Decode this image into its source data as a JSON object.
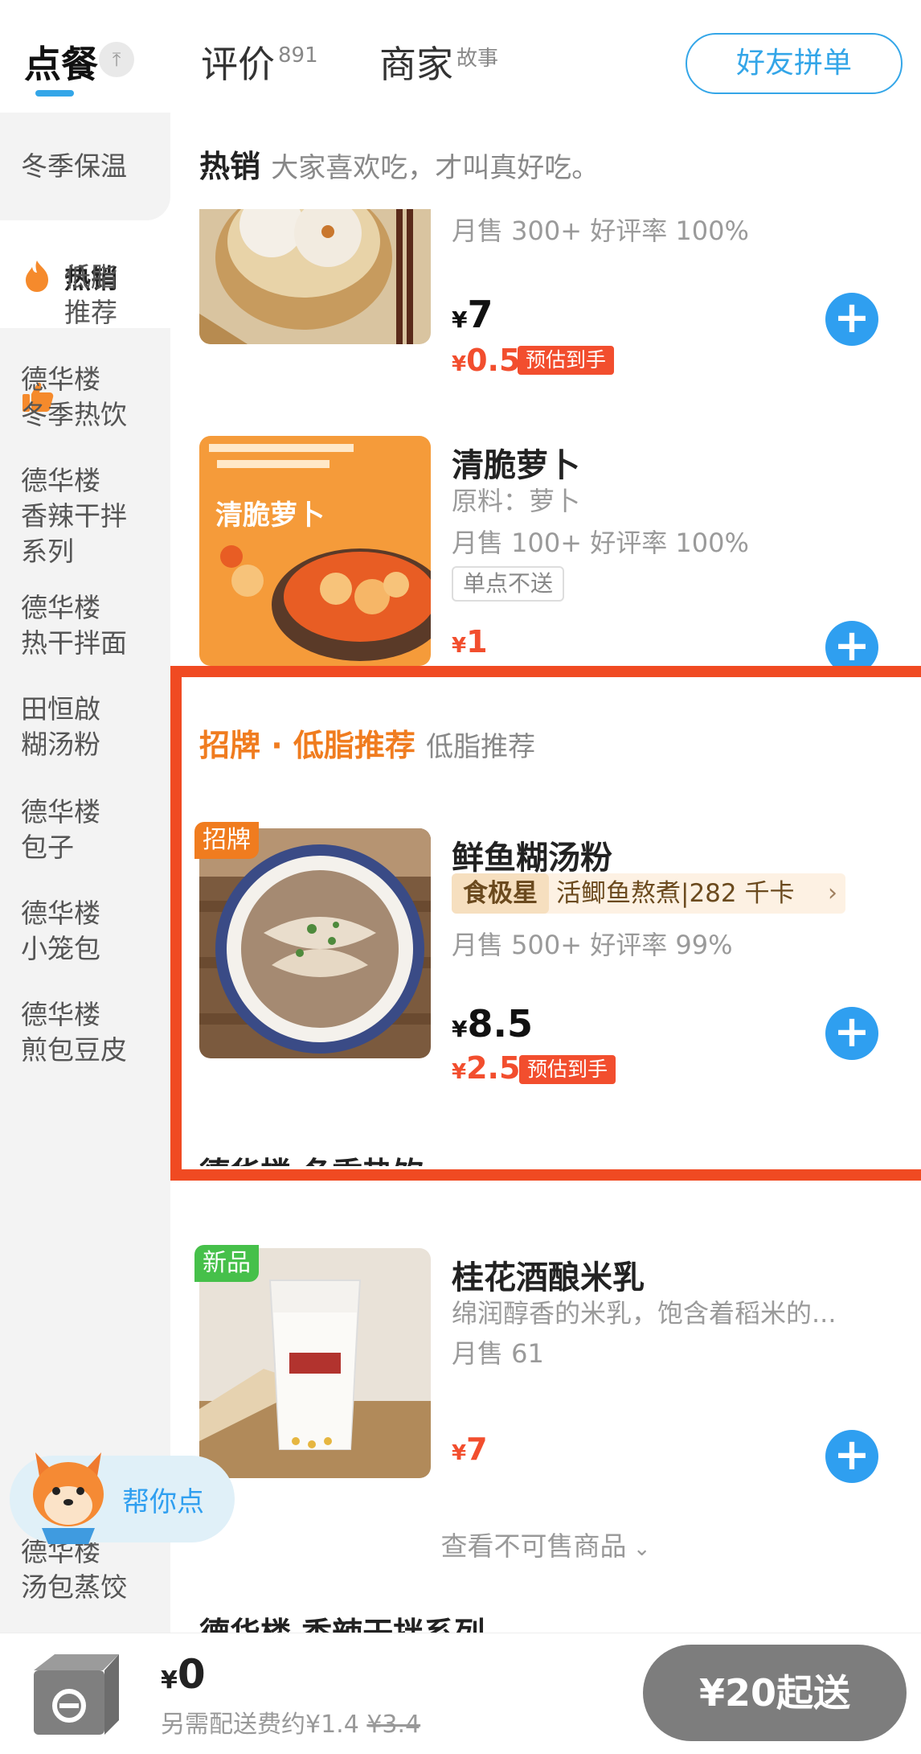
{
  "tabs": {
    "order": "点餐",
    "pin_icon": "⤒",
    "reviews": "评价",
    "reviews_count": "891",
    "merchant": "商家",
    "merchant_sup": "故事",
    "friends_button": "好友拼单"
  },
  "sidebar": {
    "items": [
      "冬季保温",
      "热销",
      "低脂\n推荐",
      "德华楼\n冬季热饮",
      "德华楼\n香辣干拌\n系列",
      "德华楼\n热干拌面",
      "田恒啟\n糊汤粉",
      "德华楼\n包子",
      "德华楼\n小笼包",
      "德华楼\n煎包豆皮",
      "德华楼\n汤包蒸饺"
    ],
    "active_index": 1
  },
  "sections": {
    "hot_title": "热销",
    "hot_sub": "大家喜欢吃，才叫真好吃。",
    "signature_title": "招牌 · 低脂推荐",
    "signature_sub": "低脂推荐",
    "winter_title_cut": "德华楼 冬季热饮",
    "spicy_title_cut": "德华楼 香辣干拌系列"
  },
  "products": {
    "bun": {
      "sales": "月售 300+ 好评率 100%",
      "currency": "¥",
      "price": "7",
      "est_price": "0.5",
      "est_label": "预估到手"
    },
    "radish": {
      "name": "清脆萝卜",
      "ingredients": "原料：萝卜",
      "sales": "月售 100+ 好评率 100%",
      "tag": "单点不送",
      "currency": "¥",
      "price": "1"
    },
    "fish_noodle": {
      "corner": "招牌",
      "name": "鲜鱼糊汤粉",
      "star_badge": "食极星",
      "star_text": "活鲫鱼熬煮|282 千卡",
      "sales": "月售 500+ 好评率 99%",
      "currency": "¥",
      "price": "8.5",
      "est_price": "2.5",
      "est_label": "预估到手"
    },
    "rice_milk": {
      "corner": "新品",
      "name": "桂花酒酿米乳",
      "desc": "绵润醇香的米乳，饱含着稻米的...",
      "sales": "月售 61",
      "currency": "¥",
      "price": "7"
    }
  },
  "see_unavailable": "查看不可售商品",
  "helper_label": "帮你点",
  "cart": {
    "currency": "¥",
    "total": "0",
    "fee_text": "另需配送费约¥1.4",
    "fee_original": "¥3.4",
    "min_order_button": "¥20起送"
  },
  "colors": {
    "accent_blue": "#2f9ff0",
    "price_red": "#f24e2e",
    "highlight_red": "#f04a22",
    "orange_title": "#f07c1f"
  }
}
